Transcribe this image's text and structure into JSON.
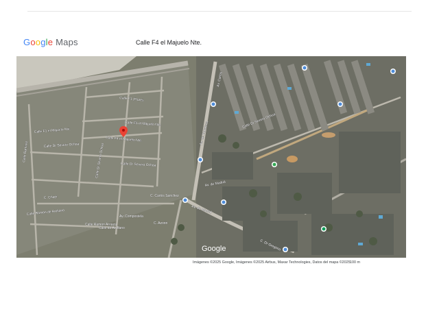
{
  "header": {
    "logo_text": "Google",
    "logo_suffix": "Maps",
    "title": "Calle F4 el Majuelo Nte."
  },
  "map": {
    "watermark": "Google",
    "pin_color": "#ea4335",
    "street_labels": {
      "s1": "Calle F1 (Flores",
      "s2": "Calle F1 el Majuelo Nte.",
      "s3": "Calle F4 el Majuelo Nte.",
      "s4": "Calle F5 el Majuelo Nte.",
      "s5": "Calle Dr Severo Ochoa",
      "s6": "Calle Dr Severo Ochoa",
      "s7": "Calle Dr Severo Ochoa",
      "s8": "Av. de Fortaleza",
      "s9": "Av. Carlos",
      "s10": "Calle Ramirez",
      "s11": "C. Chapi",
      "s12": "C. Carlos Sanchez",
      "s13": "Av. de Madrid",
      "s14": "Calle Dr Severo Ochoa",
      "s15": "Av. de Madrid",
      "s16": "Calle Ramon Arriaza",
      "s17": "C. Azorin",
      "s18": "Av. Compostela",
      "s19": "C. Dr Gregorio",
      "s20": "Calle Ramon de Arellano",
      "s21": "Calle de Arellano"
    }
  },
  "footer": {
    "attribution": "Imágenes ©2025 Google, Imágenes ©2025 Airbus, Maxar Technologies, Datos del mapa ©2025",
    "scale": "100 m"
  }
}
